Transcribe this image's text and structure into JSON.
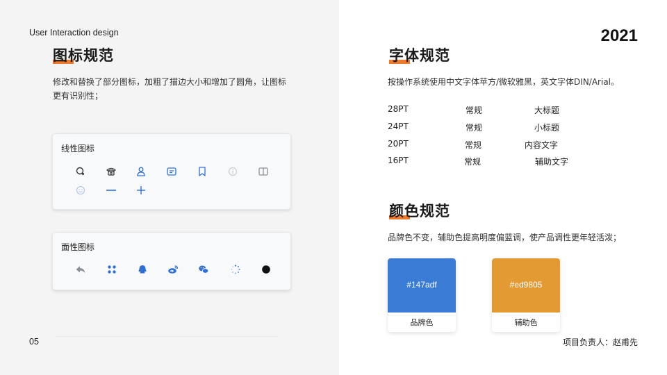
{
  "header": {
    "brand": "User Interaction design",
    "year": "2021"
  },
  "footer": {
    "page_number": "05",
    "owner": "项目负责人：赵甫先"
  },
  "icons_section": {
    "title": "图标规范",
    "description_line1": "修改和替换了部分图标，加粗了描边大小和增加了圆角，让图标",
    "description_line2": "更有识别性；",
    "line_card": {
      "title": "线性图标",
      "icons": [
        "search-icon",
        "phone-icon",
        "user-icon",
        "message-icon",
        "bookmark-icon",
        "info-icon",
        "book-icon",
        "smile-icon",
        "minus-icon",
        "plus-icon"
      ]
    },
    "fill_card": {
      "title": "面性图标",
      "icons": [
        "reply-icon",
        "apps-icon",
        "qq-icon",
        "weibo-icon",
        "wechat-icon",
        "loading-icon",
        "dot-icon"
      ]
    }
  },
  "font_section": {
    "title": "字体规范",
    "description": "按操作系统使用中文字体苹方/微软雅黑，英文字体DIN/Arial。",
    "rows": [
      {
        "size": "28PT",
        "weight": "常规",
        "usage": "大标题"
      },
      {
        "size": "24PT",
        "weight": "常规",
        "usage": "小标题"
      },
      {
        "size": "20PT",
        "weight": "常规",
        "usage": "内容文字"
      },
      {
        "size": "16PT",
        "weight": "常规",
        "usage": "辅助文字"
      }
    ]
  },
  "color_section": {
    "title": "颜色规范",
    "description": "品牌色不变，辅助色提高明度偏蓝调，使产品调性更年轻活泼；",
    "swatches": [
      {
        "hex": "#147adf",
        "name": "品牌色",
        "color": "#3a7bd5"
      },
      {
        "hex": "#ed9805",
        "name": "辅助色",
        "color": "#e39a33"
      }
    ]
  },
  "colors": {
    "accent_highlight": "#ed7a2a",
    "icon_blue": "#2f6fd6",
    "icon_gray": "#8a8f99",
    "icon_light": "#c7cbd3"
  }
}
